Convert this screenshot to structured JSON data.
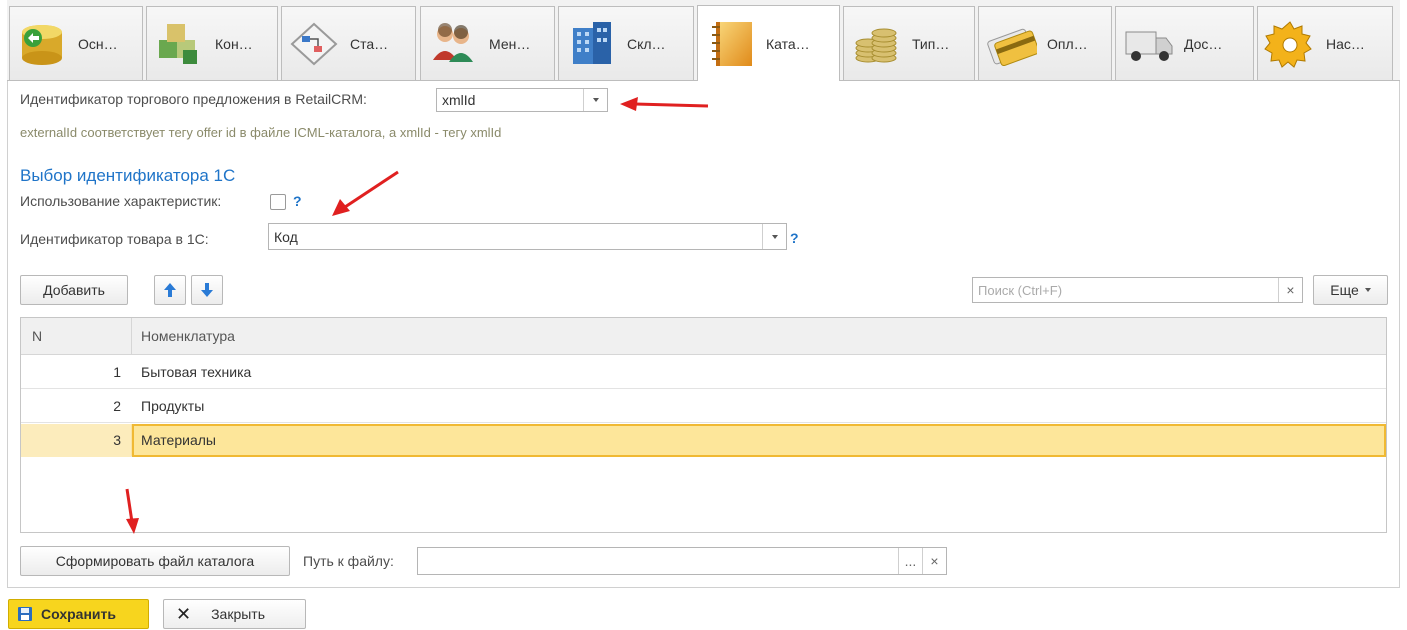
{
  "tabs": [
    {
      "label": "Осн…",
      "icon": "database-icon"
    },
    {
      "label": "Кон…",
      "icon": "blocks-icon"
    },
    {
      "label": "Ста…",
      "icon": "workflow-icon"
    },
    {
      "label": "Мен…",
      "icon": "users-icon"
    },
    {
      "label": "Скл…",
      "icon": "warehouse-icon"
    },
    {
      "label": "Ката…",
      "icon": "catalog-book-icon"
    },
    {
      "label": "Тип…",
      "icon": "coins-icon"
    },
    {
      "label": "Опл…",
      "icon": "credit-card-icon"
    },
    {
      "label": "Дос…",
      "icon": "delivery-truck-icon"
    },
    {
      "label": "Нас…",
      "icon": "gear-icon"
    }
  ],
  "active_tab": 5,
  "offer_id": {
    "label": "Идентификатор торгового предложения в RetailCRM:",
    "value": "xmlId",
    "hint": "externalId соответствует тегу offer id в файле ICML-каталога, а xmlId - тегу xmlId"
  },
  "section": {
    "title": "Выбор идентификатора 1С",
    "use_characteristics_label": "Использование характеристик:",
    "use_characteristics_checked": false,
    "help": "?",
    "product_id_label": "Идентификатор товара в 1С:",
    "product_id_value": "Код"
  },
  "toolbar": {
    "add_label": "Добавить",
    "search_placeholder": "Поиск (Ctrl+F)",
    "clear": "×",
    "more_label": "Еще"
  },
  "table": {
    "columns": [
      "N",
      "Номенклатура"
    ],
    "rows": [
      {
        "n": "1",
        "name": "Бытовая техника"
      },
      {
        "n": "2",
        "name": "Продукты"
      },
      {
        "n": "3",
        "name": "Материалы"
      }
    ],
    "selected_row": 3
  },
  "file": {
    "generate_label": "Сформировать файл каталога",
    "path_label": "Путь к файлу:",
    "path_value": "",
    "browse": "...",
    "clear": "×"
  },
  "footer": {
    "save_label": "Сохранить",
    "close_label": "Закрыть"
  },
  "colors": {
    "accent_blue": "#1f74c8",
    "annotation_red": "#e02020",
    "selection": "#fde69a",
    "save_yellow": "#f7d51e"
  }
}
